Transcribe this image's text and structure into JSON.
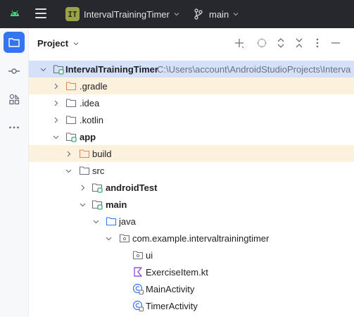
{
  "titlebar": {
    "project_badge": "IT",
    "project_name": "IntervalTrainingTimer",
    "branch": "main"
  },
  "panel": {
    "title": "Project"
  },
  "tree": [
    {
      "label": "IntervalTrainingTimer",
      "path": "C:\\Users\\account\\AndroidStudioProjects\\Interva",
      "bold": true,
      "icon": "module-folder-icon",
      "expanded": true
    },
    {
      "label": ".gradle",
      "icon": "folder-excluded-icon",
      "expanded": false
    },
    {
      "label": ".idea",
      "icon": "folder-icon",
      "expanded": false
    },
    {
      "label": ".kotlin",
      "icon": "folder-icon",
      "expanded": false
    },
    {
      "label": "app",
      "bold": true,
      "icon": "module-folder-icon",
      "expanded": true
    },
    {
      "label": "build",
      "icon": "folder-excluded-icon",
      "expanded": false
    },
    {
      "label": "src",
      "icon": "folder-icon",
      "expanded": true
    },
    {
      "label": "androidTest",
      "bold": true,
      "icon": "module-folder-icon",
      "expanded": false
    },
    {
      "label": "main",
      "bold": true,
      "icon": "module-folder-icon",
      "expanded": true
    },
    {
      "label": "java",
      "icon": "source-folder-icon",
      "expanded": true
    },
    {
      "label": "com.example.intervaltrainingtimer",
      "icon": "package-icon",
      "expanded": true
    },
    {
      "label": "ui",
      "icon": "package-icon"
    },
    {
      "label": "ExerciseItem.kt",
      "icon": "kotlin-file-icon"
    },
    {
      "label": "MainActivity",
      "icon": "class-icon"
    },
    {
      "label": "TimerActivity",
      "icon": "class-icon"
    }
  ],
  "colors": {
    "titlebar_bg": "#27282e",
    "accent": "#3574f0",
    "selected_row": "#d5e1f8",
    "excluded_row": "#fcf1dd",
    "excluded_folder": "#e08855",
    "module_marker": "#3aa76d"
  }
}
